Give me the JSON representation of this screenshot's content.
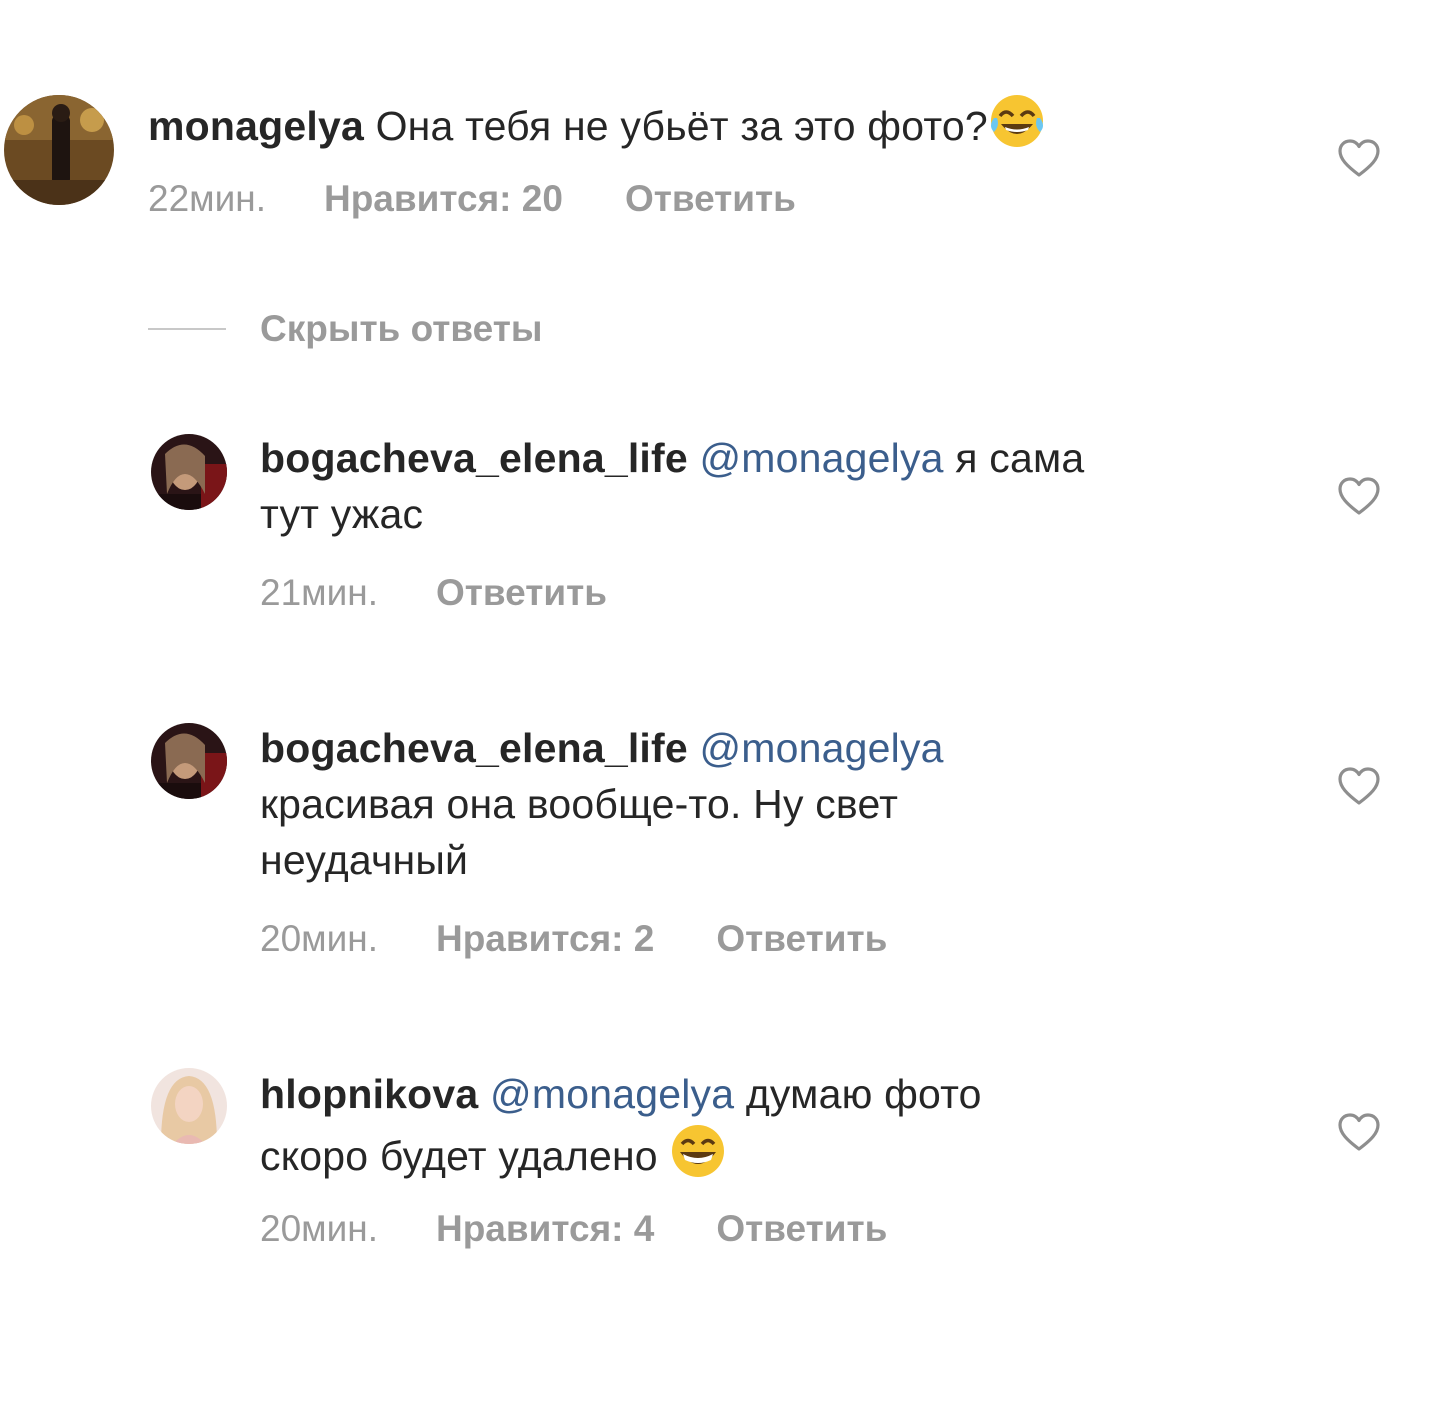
{
  "comments": [
    {
      "username": "monagelya",
      "mention": "",
      "text": "Она тебя не убьёт за это фото?",
      "emoji": "face-with-tears-of-joy-emoji",
      "time": "22мин.",
      "likes": "Нравится: 20",
      "reply": "Ответить"
    },
    {
      "username": "bogacheva_elena_life",
      "mention": "@monagelya",
      "text_line1": "я сама",
      "text_line2": "тут ужас",
      "time": "21мин.",
      "reply": "Ответить"
    },
    {
      "username": "bogacheva_elena_life",
      "mention": "@monagelya",
      "text_line1": "красивая она вообще-то. Ну свет",
      "text_line2": "неудачный",
      "time": "20мин.",
      "likes": "Нравится: 2",
      "reply": "Ответить"
    },
    {
      "username": "hlopnikova",
      "mention": "@monagelya",
      "text_line1": "думаю фото",
      "text_line2": "скоро будет удалено",
      "emoji": "grinning-face-emoji",
      "time": "20мин.",
      "likes": "Нравится: 4",
      "reply": "Ответить"
    }
  ],
  "thread": {
    "hide_replies_label": "Скрыть ответы"
  },
  "icons": {
    "like": "heart-icon"
  },
  "colors": {
    "text": "#262626",
    "secondary": "#9a9a9a",
    "mention": "#3b5e8c"
  }
}
